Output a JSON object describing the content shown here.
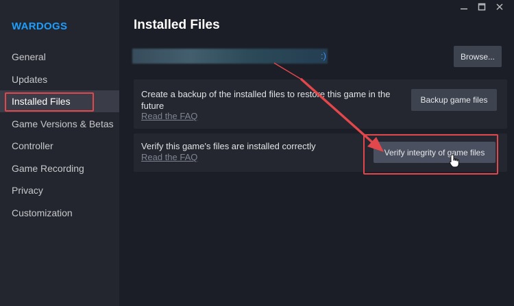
{
  "sidebar": {
    "game_title": "WARDOGS",
    "items": [
      {
        "label": "General"
      },
      {
        "label": "Updates"
      },
      {
        "label": "Installed Files"
      },
      {
        "label": "Game Versions & Betas"
      },
      {
        "label": "Controller"
      },
      {
        "label": "Game Recording"
      },
      {
        "label": "Privacy"
      },
      {
        "label": "Customization"
      }
    ],
    "active": "Installed Files"
  },
  "window": {
    "minimize_icon": "minimize-icon",
    "maximize_icon": "maximize-icon",
    "close_icon": "close-icon"
  },
  "main": {
    "title": "Installed Files",
    "path_suffix": ":)",
    "browse_label": "Browse...",
    "backup": {
      "text_line1": "Create a backup of the installed files to restore this game in the",
      "text_line2": "future",
      "faq": "Read the FAQ",
      "button": "Backup game files"
    },
    "verify": {
      "text": "Verify this game's files are installed correctly",
      "faq": "Read the FAQ",
      "button": "Verify integrity of game files"
    }
  },
  "colors": {
    "accent": "#1a9fff",
    "annotation": "#e2474b",
    "background": "#1b1e26",
    "sidebar": "#24262f"
  }
}
